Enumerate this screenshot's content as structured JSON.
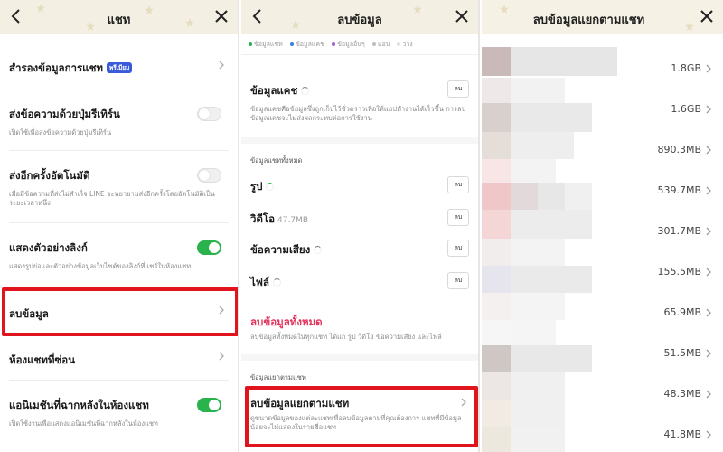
{
  "colors": {
    "header_bg": "#f3efe2",
    "toggle_on": "#2ab24c",
    "highlight": "#e0141c",
    "danger_text": "#e0345d",
    "badge_bg": "#3a5bd9"
  },
  "icons": {
    "back": "chevron-left-icon",
    "close": "close-icon",
    "row": "chevron-right-icon",
    "spinner": "loading-spinner-icon"
  },
  "panel1": {
    "title": "แชท",
    "rows": [
      {
        "title": "สำรองข้อมูลการแชท",
        "badge": "พรีเมียม"
      },
      {
        "title": "ส่งข้อความด้วยปุ่มรีเทิร์น",
        "sub": "เปิดใช้เพื่อส่งข้อความด้วยปุ่มรีเทิร์น",
        "toggle": false
      },
      {
        "title": "ส่งอีกครั้งอัตโนมัติ",
        "sub": "เมื่อมีข้อความที่ส่งไม่สำเร็จ LINE จะพยายามส่งอีกครั้งโดยอัตโนมัติเป็นระยะเวลาหนึ่ง",
        "toggle": false
      },
      {
        "title": "แสดงตัวอย่างลิงก์",
        "sub": "แสดงรูปย่อและตัวอย่างข้อมูลเว็บไซต์ของลิงก์ที่แชร์ในห้องแชท",
        "toggle": true
      },
      {
        "title": "ลบข้อมูล"
      },
      {
        "title": "ห้องแชทที่ซ่อน"
      },
      {
        "title": "แอนิเมชันที่ฉากหลังในห้องแชท",
        "sub": "เปิดใช้งานเพื่อแสดงแอนิเมชันที่ฉากหลังในห้องแชท",
        "toggle": true
      }
    ]
  },
  "panel2": {
    "title": "ลบข้อมูล",
    "legend": [
      "ข้อมูลแชท",
      "ข้อมูลแคช",
      "ข้อมูลอื่นๆ",
      "แอป",
      "ว่าง"
    ],
    "legend_colors": [
      "#2ab24c",
      "#3b7be0",
      "#a060d0",
      "#bdbdbd",
      "#e0e0e0"
    ],
    "cache": {
      "title": "ข้อมูลแคช",
      "desc": "ข้อมูลแคชคือข้อมูลซึ่งถูกเก็บไว้ชั่วคราวเพื่อให้แอปทำงานได้เร็วขึ้น การลบข้อมูลแคชจะไม่ส่งผลกระทบต่อการใช้งาน",
      "button": "ลบ"
    },
    "all_group": "ข้อมูลแชททั้งหมด",
    "items": [
      {
        "label": "รูป",
        "size": "",
        "button": "ลบ"
      },
      {
        "label": "วิดีโอ",
        "size": "47.7MB",
        "button": "ลบ"
      },
      {
        "label": "ข้อความเสียง",
        "size": "",
        "button": "ลบ"
      },
      {
        "label": "ไฟล์",
        "size": "",
        "button": "ลบ"
      }
    ],
    "delete_all": {
      "title": "ลบข้อมูลทั้งหมด",
      "desc": "ลบข้อมูลทั้งหมดในทุกแชท ได้แก่ รูป วิดีโอ ข้อความเสียง และไฟล์"
    },
    "per_chat_group": "ข้อมูลแยกตามแชท",
    "per_chat": {
      "title": "ลบข้อมูลแยกตามแชท",
      "desc": "ดูขนาดข้อมูลของแต่ละแชทเพื่อลบข้อมูลตามที่คุณต้องการ แชทที่มีข้อมูลน้อยจะไม่แสดงในรายชื่อแชท"
    }
  },
  "panel3": {
    "title": "ลบข้อมูลแยกตามแชท",
    "sizes": [
      "1.8GB",
      "1.6GB",
      "890.3MB",
      "539.7MB",
      "301.7MB",
      "155.5MB",
      "65.9MB",
      "51.5MB",
      "48.3MB",
      "41.8MB"
    ]
  }
}
